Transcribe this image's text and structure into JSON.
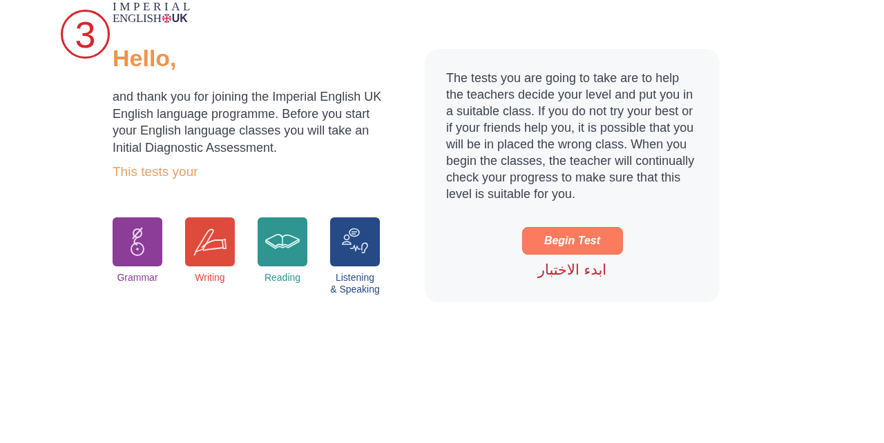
{
  "step_marker": "3",
  "logo": {
    "line_1": "IMPERIAL",
    "line_2": "ENGLISH",
    "badge": "UK"
  },
  "greeting": "Hello,",
  "intro": "and thank you for joining the Imperial English UK English language programme. Before you start your English language classes you will take an Initial Diagnostic Assessment.",
  "tests_heading": "This tests your",
  "skills": [
    {
      "kind": "grammar",
      "label": "Grammar",
      "color": "#8b3d97"
    },
    {
      "kind": "writing",
      "label": "Writing",
      "color": "#de4a3c"
    },
    {
      "kind": "reading",
      "label": "Reading",
      "color": "#2e9590"
    },
    {
      "kind": "listening",
      "label": "Listening\n& Speaking",
      "color": "#254a85"
    }
  ],
  "info_panel": {
    "text": "The tests you are going to take are to help the teachers decide your level and put you in a suitable class. If you do not try your best or if your friends help you, it is possible that you will be in placed the wrong class. When you begin the classes, the teacher will continually check your progress to make sure that this level is suitable for you.",
    "button": "Begin Test",
    "caption": "ابدء الاختبار"
  }
}
